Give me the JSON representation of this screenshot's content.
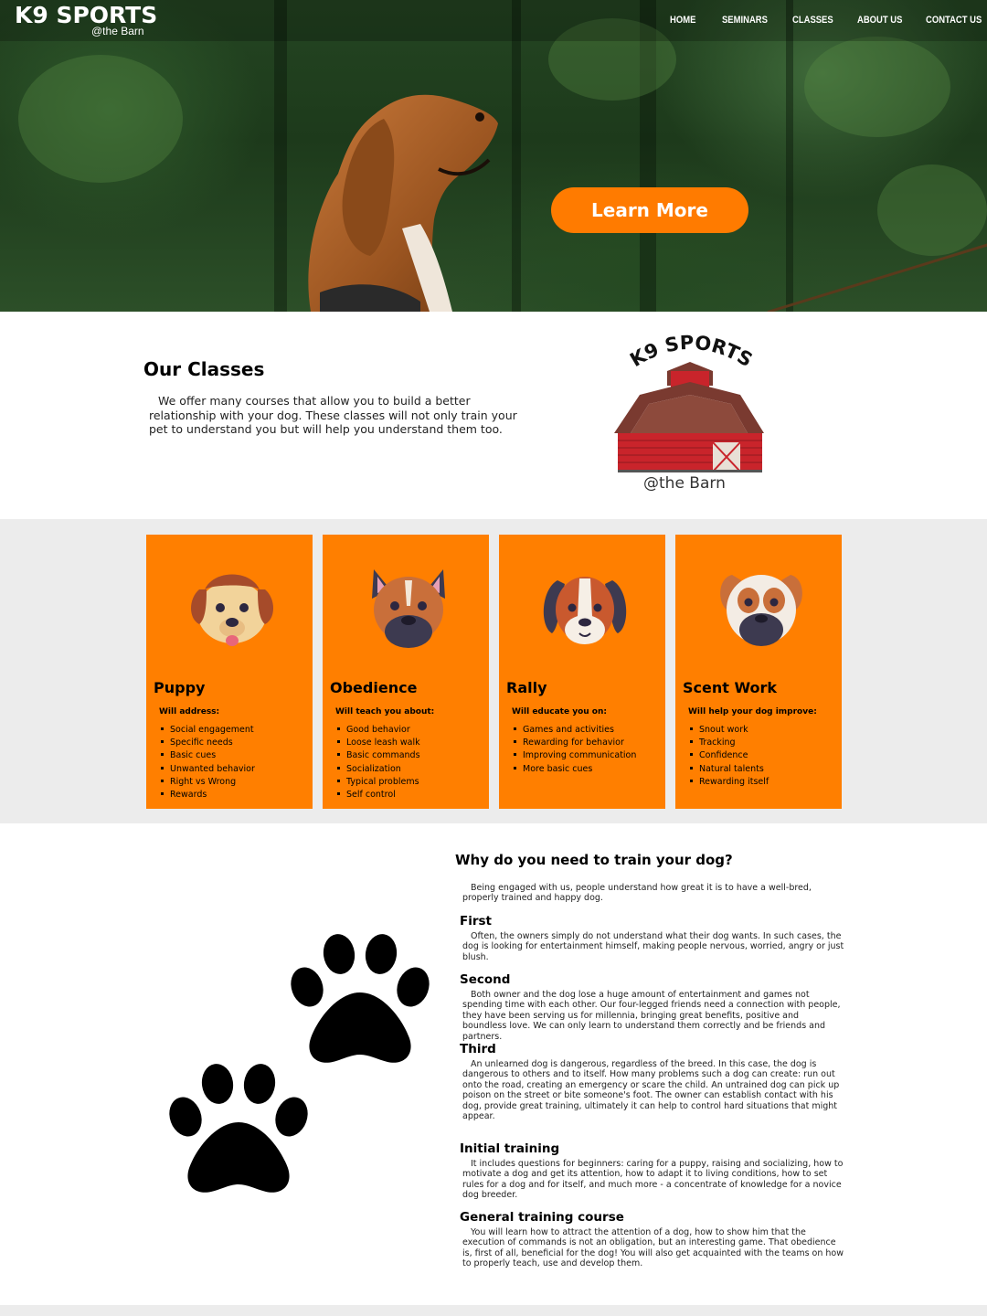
{
  "header": {
    "logo_title": "K9 SPORTS",
    "logo_subtitle": "@the Barn",
    "nav": [
      "HOME",
      "SEMINARS",
      "CLASSES",
      "ABOUT US",
      "CONTACT US"
    ]
  },
  "hero": {
    "cta_label": "Learn More"
  },
  "classes_intro": {
    "title": "Our Classes",
    "text": "We offer many courses that allow you to build a better relationship with your dog. These classes will not only train your pet to understand you but will help you understand them too.",
    "logo_title": "K9 SPORTS",
    "logo_subtitle": "@the Barn"
  },
  "cards": [
    {
      "title": "Puppy",
      "intro": "Will address:",
      "items": [
        "Social engagement",
        "Specific needs",
        "Basic cues",
        "Unwanted behavior",
        "Right vs Wrong",
        "Rewards"
      ]
    },
    {
      "title": "Obedience",
      "intro": "Will teach you about:",
      "items": [
        "Good behavior",
        "Loose leash walk",
        "Basic commands",
        "Socialization",
        "Typical problems",
        "Self control"
      ]
    },
    {
      "title": "Rally",
      "intro": "Will educate you on:",
      "items": [
        "Games and activities",
        "Rewarding for behavior",
        "Improving communication",
        "More basic cues"
      ]
    },
    {
      "title": "Scent Work",
      "intro": "Will help your dog improve:",
      "items": [
        "Snout work",
        "Tracking",
        "Confidence",
        "Natural talents",
        "Rewarding itself"
      ]
    }
  ],
  "why": {
    "title": "Why do you need to train your dog?",
    "intro": "Being engaged with us, people understand how great it is to have a well-bred, properly trained and happy dog.",
    "sections": [
      {
        "heading": "First",
        "text": "Often, the owners simply do not understand what their dog wants. In such cases, the dog is looking for entertainment himself, making people nervous, worried, angry or just blush."
      },
      {
        "heading": "Second",
        "text": "Both owner and the dog lose a huge amount of entertainment and games not spending time with each other. Our four-legged friends need a connection with people, they have been serving us for millennia, bringing great benefits, positive and boundless love. We can only learn to understand them correctly and be friends and partners."
      },
      {
        "heading": "Third",
        "text": "An unlearned dog is dangerous, regardless of the breed. In this case, the dog is dangerous to others and to itself. How many problems such a dog can create: run out onto the road, creating an emergency or scare the child. An untrained dog can pick up poison on the street or bite someone's foot. The owner can establish contact with his dog, provide great training, ultimately it can help to control hard situations that might appear."
      },
      {
        "heading": "Initial training",
        "text": "It includes questions for beginners: caring for a puppy, raising and socializing, how to motivate a dog and get its attention, how to adapt it to living conditions, how to set rules for a dog and for itself, and much more - a concentrate of knowledge for a novice dog breeder."
      },
      {
        "heading": "General training course",
        "text": "You will learn how to attract the attention of a dog, how to show him that the execution of commands is not an obligation, but an interesting game. That obedience is, first of all, beneficial for the dog! You will also get acquainted with the teams on how to properly teach, use and develop them."
      }
    ]
  },
  "colors": {
    "accent": "#ff7f00",
    "band": "#ececec"
  }
}
